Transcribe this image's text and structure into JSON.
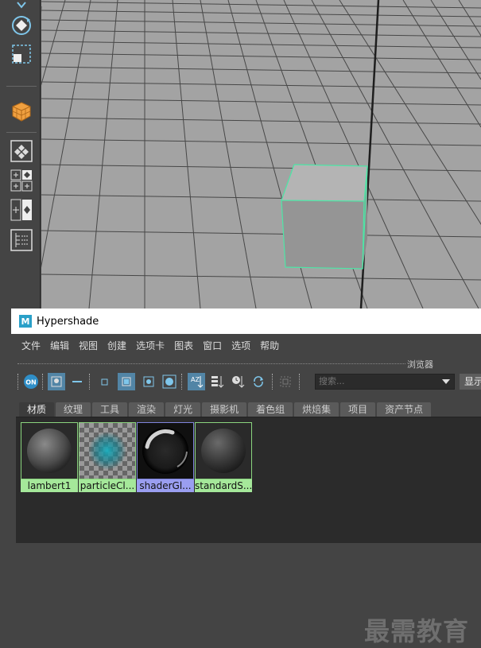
{
  "hypershade": {
    "title": "Hypershade",
    "logo_letter": "M",
    "menus": [
      "文件",
      "编辑",
      "视图",
      "创建",
      "选项卡",
      "图表",
      "窗口",
      "选项",
      "帮助"
    ],
    "browser_label": "浏览器",
    "toolbar": {
      "on_label": "ON",
      "sort_label": "AZ",
      "search_placeholder": "搜索...",
      "show_label": "显示"
    },
    "tabs": [
      {
        "label": "材质",
        "active": true
      },
      {
        "label": "纹理",
        "active": false
      },
      {
        "label": "工具",
        "active": false
      },
      {
        "label": "渲染",
        "active": false
      },
      {
        "label": "灯光",
        "active": false
      },
      {
        "label": "摄影机",
        "active": false
      },
      {
        "label": "着色组",
        "active": false
      },
      {
        "label": "烘焙集",
        "active": false
      },
      {
        "label": "项目",
        "active": false
      },
      {
        "label": "资产节点",
        "active": false
      }
    ],
    "materials": [
      {
        "label": "lambert1",
        "kind": "lambert",
        "label_color": "#a5e89a",
        "border_color": "#8ad47e"
      },
      {
        "label": "particleCl...",
        "kind": "particle",
        "label_color": "#a5e89a",
        "border_color": "#8ad47e"
      },
      {
        "label": "shaderGl...",
        "kind": "glow",
        "label_color": "#9a9ef0",
        "border_color": "#7f84dc"
      },
      {
        "label": "standardS...",
        "kind": "standard",
        "label_color": "#a5e89a",
        "border_color": "#8ad47e"
      }
    ]
  },
  "tools": [
    "chevron-down-icon",
    "rotate-icon",
    "scale-icon",
    "mesh-cube-icon",
    "outliner-icon",
    "four-view-layout-icon",
    "two-view-layout-icon",
    "outliner-list-icon"
  ],
  "watermark": "最需教育",
  "colors": {
    "accent": "#5285a6",
    "selection": "#4de6a6",
    "grid_bg": "#a3a3a3",
    "ui_dark": "#444444"
  }
}
